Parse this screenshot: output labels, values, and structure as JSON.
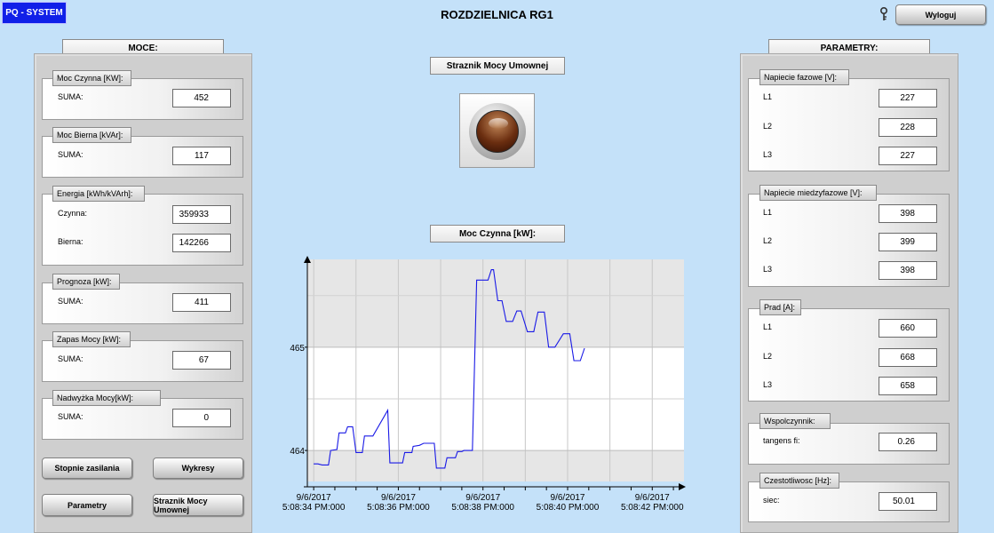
{
  "app": {
    "logo": "PQ - SYSTEM",
    "title": "ROZDZIELNICA RG1",
    "logout_label": "Wyloguj"
  },
  "left": {
    "header": "MOCE:",
    "groups": [
      {
        "title": "Moc Czynna [KW]:",
        "rows": [
          {
            "label": "SUMA:",
            "value": "452"
          }
        ]
      },
      {
        "title": "Moc Bierna [kVAr]:",
        "rows": [
          {
            "label": "SUMA:",
            "value": "117"
          }
        ]
      },
      {
        "title": "Energia [kWh/kVArh]:",
        "rows": [
          {
            "label": "Czynna:",
            "value": "359933"
          },
          {
            "label": "Bierna:",
            "value": "142266"
          }
        ]
      },
      {
        "title": "Prognoza [kW]:",
        "rows": [
          {
            "label": "SUMA:",
            "value": "411"
          }
        ]
      },
      {
        "title": "Zapas Mocy [kW]:",
        "rows": [
          {
            "label": "SUMA:",
            "value": "67"
          }
        ]
      },
      {
        "title": "Nadwyżka Mocy[kW]:",
        "rows": [
          {
            "label": "SUMA:",
            "value": "0"
          }
        ]
      }
    ],
    "buttons": {
      "supply_stages": "Stopnie zasilania",
      "charts": "Wykresy",
      "parameters": "Parametry",
      "guard": "Straznik Mocy Umownej"
    }
  },
  "center": {
    "guard_title": "Straznik Mocy Umownej",
    "chart_title": "Moc Czynna [kW]:"
  },
  "right": {
    "header": "PARAMETRY:",
    "groups": [
      {
        "title": "Napiecie fazowe [V]:",
        "rows": [
          {
            "label": "L1",
            "value": "227"
          },
          {
            "label": "L2",
            "value": "228"
          },
          {
            "label": "L3",
            "value": "227"
          }
        ]
      },
      {
        "title": "Napiecie miedzyfazowe [V]:",
        "rows": [
          {
            "label": "L1",
            "value": "398"
          },
          {
            "label": "L2",
            "value": "399"
          },
          {
            "label": "L3",
            "value": "398"
          }
        ]
      },
      {
        "title": "Prad [A]:",
        "rows": [
          {
            "label": "L1",
            "value": "660"
          },
          {
            "label": "L2",
            "value": "668"
          },
          {
            "label": "L3",
            "value": "658"
          }
        ]
      },
      {
        "title": "Wspolczynnik:",
        "rows": [
          {
            "label": "tangens fi:",
            "value": "0.26"
          }
        ]
      },
      {
        "title": "Czestotliwosc [Hz]:",
        "rows": [
          {
            "label": "siec:",
            "value": "50.01"
          }
        ]
      }
    ]
  },
  "chart_data": {
    "type": "line",
    "title": "Moc Czynna [kW]:",
    "ytick_labels": [
      "464",
      "465"
    ],
    "xtick_labels": [
      [
        "9/6/2017",
        "5:08:34 PM:000"
      ],
      [
        "9/6/2017",
        "5:08:36 PM:000"
      ],
      [
        "9/6/2017",
        "5:08:38 PM:000"
      ],
      [
        "9/6/2017",
        "5:08:40 PM:000"
      ],
      [
        "9/6/2017",
        "5:08:42 PM:000"
      ]
    ],
    "xlim_s": [
      33.85,
      42.75
    ],
    "ylim": [
      463.7,
      465.85
    ],
    "series": [
      {
        "color": "#1a1ae6",
        "points": [
          [
            34.0,
            463.87
          ],
          [
            34.1,
            463.87
          ],
          [
            34.2,
            463.86
          ],
          [
            34.35,
            463.86
          ],
          [
            34.4,
            464.0
          ],
          [
            34.55,
            464.01
          ],
          [
            34.6,
            464.17
          ],
          [
            34.75,
            464.17
          ],
          [
            34.8,
            464.23
          ],
          [
            34.92,
            464.23
          ],
          [
            35.0,
            463.98
          ],
          [
            35.15,
            463.98
          ],
          [
            35.2,
            464.14
          ],
          [
            35.4,
            464.14
          ],
          [
            35.75,
            464.39
          ],
          [
            35.8,
            463.88
          ],
          [
            36.1,
            463.88
          ],
          [
            36.15,
            463.98
          ],
          [
            36.32,
            463.98
          ],
          [
            36.35,
            464.04
          ],
          [
            36.5,
            464.05
          ],
          [
            36.6,
            464.07
          ],
          [
            36.85,
            464.07
          ],
          [
            36.9,
            463.83
          ],
          [
            37.1,
            463.83
          ],
          [
            37.15,
            463.93
          ],
          [
            37.35,
            463.93
          ],
          [
            37.4,
            463.99
          ],
          [
            37.5,
            463.99
          ],
          [
            37.55,
            464.0
          ],
          [
            37.75,
            464.0
          ],
          [
            37.85,
            465.65
          ],
          [
            38.12,
            465.65
          ],
          [
            38.2,
            465.75
          ],
          [
            38.25,
            465.75
          ],
          [
            38.35,
            465.45
          ],
          [
            38.45,
            465.45
          ],
          [
            38.55,
            465.25
          ],
          [
            38.7,
            465.25
          ],
          [
            38.8,
            465.35
          ],
          [
            38.9,
            465.35
          ],
          [
            39.05,
            465.15
          ],
          [
            39.2,
            465.15
          ],
          [
            39.3,
            465.34
          ],
          [
            39.45,
            465.34
          ],
          [
            39.55,
            465.0
          ],
          [
            39.7,
            465.0
          ],
          [
            39.9,
            465.13
          ],
          [
            40.05,
            465.13
          ],
          [
            40.15,
            464.87
          ],
          [
            40.3,
            464.87
          ],
          [
            40.4,
            464.99
          ]
        ]
      }
    ]
  }
}
